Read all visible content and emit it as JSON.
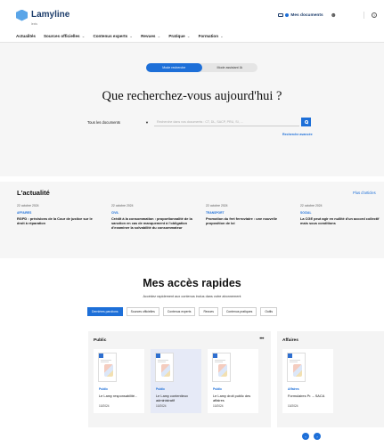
{
  "header": {
    "logo_text": "Lamyline",
    "logo_sub": "lexis",
    "my_documents": "Mes documents",
    "user_icon": "user-add-icon",
    "help_icon": "help-icon"
  },
  "nav": {
    "items": [
      {
        "label": "Actualités",
        "has_menu": false
      },
      {
        "label": "Sources officielles",
        "has_menu": true
      },
      {
        "label": "Contenus experts",
        "has_menu": true
      },
      {
        "label": "Revues",
        "has_menu": true
      },
      {
        "label": "Pratique",
        "has_menu": true
      },
      {
        "label": "Formation",
        "has_menu": true
      }
    ]
  },
  "search": {
    "modes": [
      "Mode recherche",
      "Mode assistant IA"
    ],
    "active_mode": "Mode recherche",
    "title": "Que recherchez-vous aujourd'hui ?",
    "scope": "Tous les documents",
    "placeholder": "Recherche dans vos documents : CT, DL, SACP, PRU, SI, ...",
    "advanced_link": "Recherche avancée"
  },
  "news": {
    "title": "L'actualité",
    "all_link": "Plus d'articles",
    "items": [
      {
        "date": "22 octobre 2024",
        "category": "AFFAIRES",
        "text": "RGPD : précisions de la Cour de justice sur le droit à réparation"
      },
      {
        "date": "22 octobre 2024",
        "category": "CIVIL",
        "text": "Crédit à la consommation : proportionnalité de la sanction en cas de manquement à l'obligation d'examiner la solvabilité du consommateur"
      },
      {
        "date": "22 octobre 2024",
        "category": "TRANSPORT",
        "text": "Promotion du fret ferroviaire : une nouvelle proposition de loi"
      },
      {
        "date": "22 octobre 2024",
        "category": "SOCIAL",
        "text": "La CGE peut agir en nullité d'un accord collectif mais sous conditions"
      }
    ]
  },
  "quick": {
    "title": "Mes accès rapides",
    "subtitle": "Accédez rapidement aux contenus inclus dans votre abonnement",
    "chips": [
      "Dernières parutions",
      "Sources officielles",
      "Contenus experts",
      "Revues",
      "Contenus pratiques",
      "Outils"
    ],
    "active_chip": "Dernières parutions",
    "panels": [
      {
        "title": "Public",
        "more": "•••",
        "cards": [
          {
            "tag": "Public",
            "name": "Le Lamy responsabilité...",
            "date": "10/2024"
          },
          {
            "tag": "Public",
            "name": "Le Lamy contentieux administratif",
            "date": "10/2024"
          },
          {
            "tag": "Public",
            "name": "Le Lamy droit public des affaires",
            "date": "10/2024"
          }
        ]
      },
      {
        "title": "Affaires",
        "cards": [
          {
            "tag": "Affaires",
            "name": "Formulaires Pr. – SACA",
            "date": "10/2024"
          }
        ]
      }
    ]
  },
  "pager": {
    "prev": "‹",
    "next": "›"
  },
  "colors": {
    "accent": "#1d6fd8",
    "brand": "#1d3d6b",
    "panel_bg": "#f4f4f4"
  }
}
